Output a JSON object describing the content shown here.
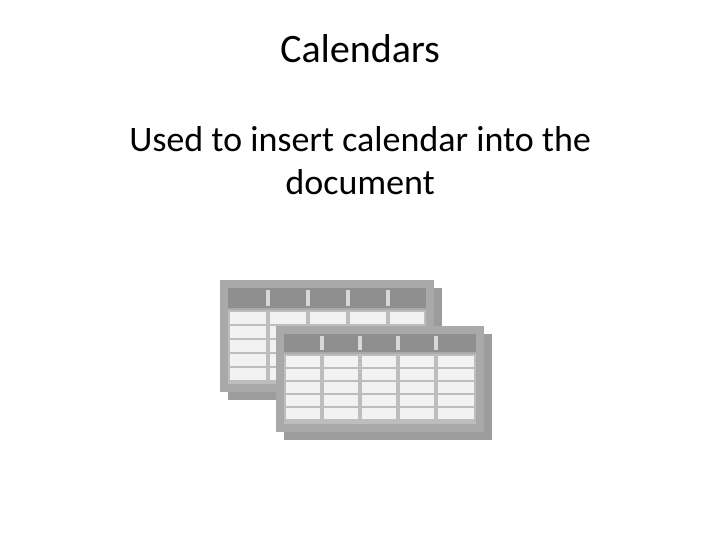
{
  "title": "Calendars",
  "subtitle": "Used to insert calendar into the document",
  "icon": "calendar-tables-icon"
}
